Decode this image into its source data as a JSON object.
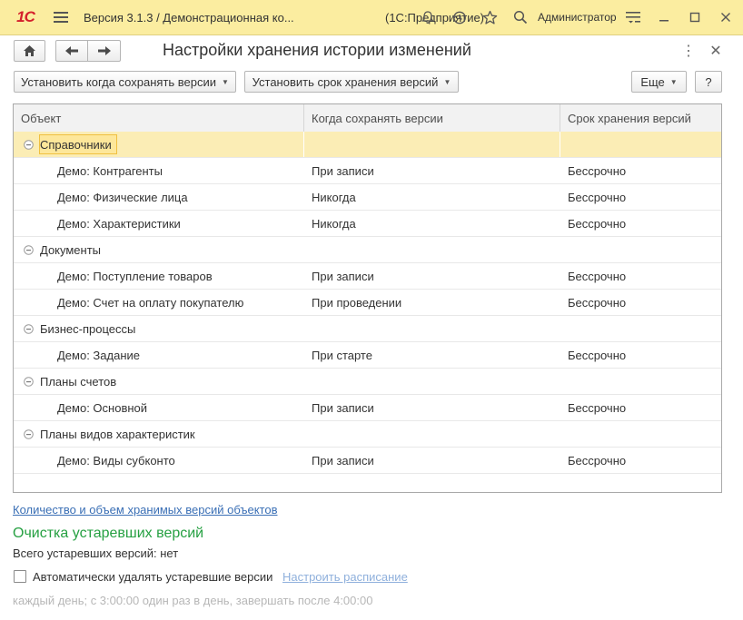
{
  "titlebar": {
    "logo": "1С",
    "window_title": "Версия 3.1.3 / Демонстрационная ко...",
    "app_name": "(1С:Предприятие)",
    "user": "Администратор"
  },
  "form": {
    "title": "Настройки хранения истории изменений"
  },
  "commandbar": {
    "set_when_label": "Установить когда сохранять версии",
    "set_period_label": "Установить срок хранения версий",
    "more_label": "Еще",
    "help_label": "?"
  },
  "table": {
    "columns": [
      "Объект",
      "Когда сохранять версии",
      "Срок хранения версий"
    ],
    "groups": [
      {
        "name": "Справочники",
        "items": [
          {
            "object": "Демо: Контрагенты",
            "when": "При записи",
            "period": "Бессрочно"
          },
          {
            "object": "Демо: Физические лица",
            "when": "Никогда",
            "period": "Бессрочно"
          },
          {
            "object": "Демо: Характеристики",
            "when": "Никогда",
            "period": "Бессрочно"
          }
        ]
      },
      {
        "name": "Документы",
        "items": [
          {
            "object": "Демо: Поступление товаров",
            "when": "При записи",
            "period": "Бессрочно"
          },
          {
            "object": "Демо: Счет на оплату покупателю",
            "when": "При проведении",
            "period": "Бессрочно"
          }
        ]
      },
      {
        "name": "Бизнес-процессы",
        "items": [
          {
            "object": "Демо: Задание",
            "when": "При старте",
            "period": "Бессрочно"
          }
        ]
      },
      {
        "name": "Планы счетов",
        "items": [
          {
            "object": "Демо: Основной",
            "when": "При записи",
            "period": "Бессрочно"
          }
        ]
      },
      {
        "name": "Планы видов характеристик",
        "items": [
          {
            "object": "Демо: Виды субконто",
            "when": "При записи",
            "period": "Бессрочно"
          }
        ]
      }
    ]
  },
  "footer": {
    "stats_link": "Количество и объем хранимых версий объектов",
    "cleanup_title": "Очистка устаревших версий",
    "obsolete_count": "Всего устаревших версий: нет",
    "auto_delete_label": "Автоматически удалять устаревшие версии",
    "auto_delete_checked": false,
    "schedule_link": "Настроить расписание",
    "schedule_text": "каждый день; с 3:00:00 один раз в день, завершать после 4:00:00"
  },
  "colors": {
    "titlebar_bg": "#fbeda0",
    "selected_row": "#fbedb5",
    "section_title": "#26a042",
    "link": "#3a6fb5",
    "logo": "#d4202c"
  }
}
